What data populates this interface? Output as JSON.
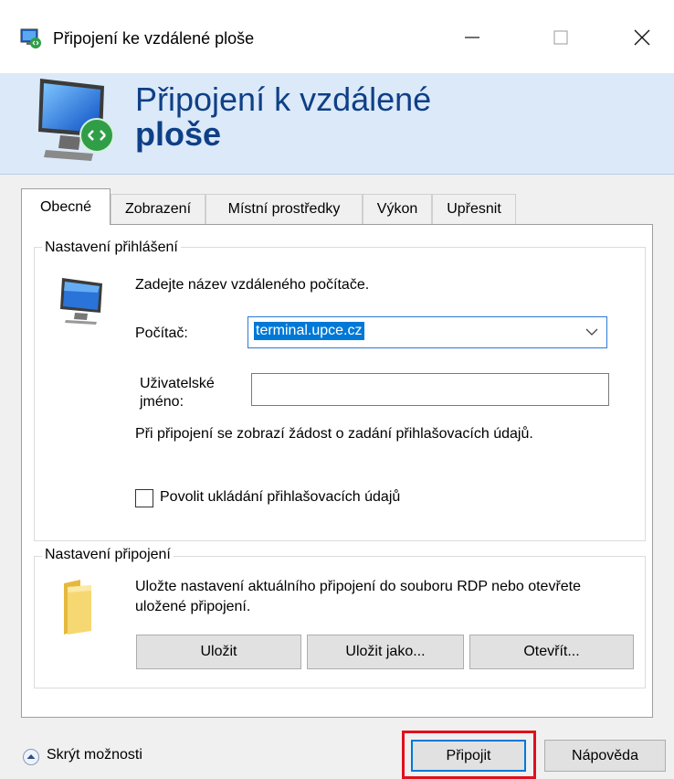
{
  "window": {
    "title": "Připojení ke vzdálené ploše"
  },
  "banner": {
    "line1": "Připojení k vzdálené",
    "line2": "ploše"
  },
  "tabs": [
    {
      "label": "Obecné",
      "active": true
    },
    {
      "label": "Zobrazení",
      "active": false
    },
    {
      "label": "Místní prostředky",
      "active": false
    },
    {
      "label": "Výkon",
      "active": false
    },
    {
      "label": "Upřesnit",
      "active": false
    }
  ],
  "login_settings": {
    "group_label": "Nastavení přihlášení",
    "instruction": "Zadejte název vzdáleného počítače.",
    "computer_label": "Počítač:",
    "computer_value": "terminal.upce.cz",
    "username_label_line1": "Uživatelské",
    "username_label_line2": "jméno:",
    "username_value": "",
    "credentials_note": "Při připojení se zobrazí žádost o zadání přihlašovacích údajů.",
    "save_credentials_label": "Povolit ukládání přihlašovacích údajů",
    "save_credentials_checked": false
  },
  "connection_settings": {
    "group_label": "Nastavení připojení",
    "note": "Uložte nastavení aktuálního připojení do souboru RDP nebo otevřete uložené připojení.",
    "save_label": "Uložit",
    "save_as_label": "Uložit jako...",
    "open_label": "Otevřít..."
  },
  "footer": {
    "hide_options_label": "Skrýt možnosti",
    "connect_label": "Připojit",
    "help_label": "Nápověda"
  },
  "colors": {
    "banner_bg": "#dbe9f9",
    "banner_text": "#0f3f86",
    "selection": "#0078d7",
    "highlight_border": "#e0101c"
  }
}
